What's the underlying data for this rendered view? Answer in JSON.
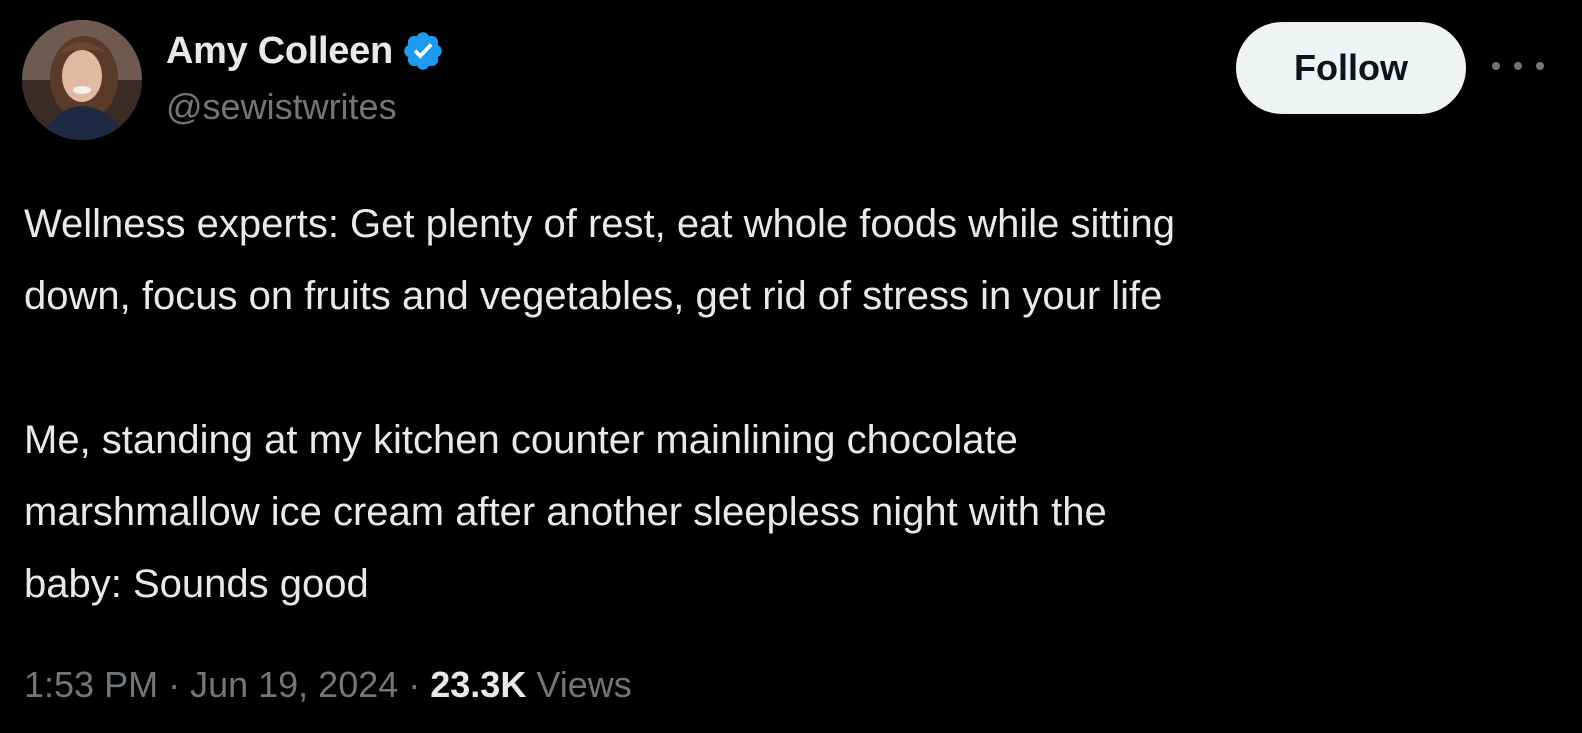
{
  "author": {
    "name": "Amy Colleen",
    "handle": "@sewistwrites",
    "verified": true,
    "verified_icon": "verified-badge-icon",
    "verified_color": "#1d9bf0"
  },
  "actions": {
    "follow_label": "Follow",
    "more_icon": "more-dots-icon"
  },
  "tweet": {
    "lines_paragraph_1": [
      "Wellness experts: Get plenty of rest, eat whole foods while sitting",
      "down, focus on fruits and vegetables, get rid of stress in your life"
    ],
    "lines_paragraph_2": [
      "Me, standing at my kitchen counter mainlining chocolate",
      "marshmallow ice cream after another sleepless night with the",
      "baby: Sounds good"
    ]
  },
  "meta": {
    "time": "1:53 PM",
    "separator": "·",
    "date": "Jun 19, 2024",
    "views_count": "23.3K",
    "views_label": "Views"
  },
  "colors": {
    "background": "#000000",
    "primary_text": "#e7e9ea",
    "secondary_text": "#71767b",
    "follow_bg": "#eff3f4",
    "follow_text": "#0f1419"
  }
}
